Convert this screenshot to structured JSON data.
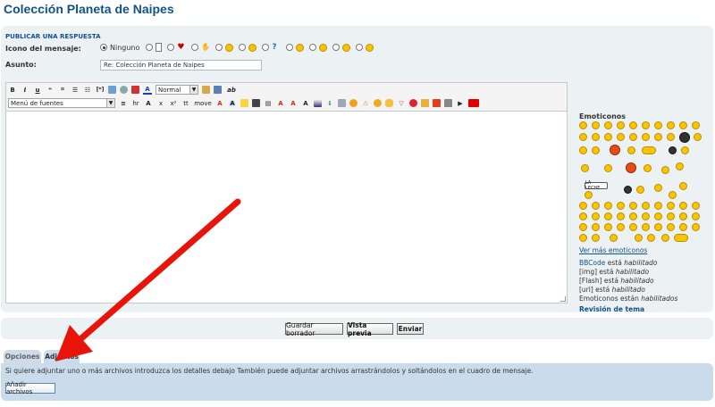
{
  "page": {
    "title": "Colección Planeta de Naipes"
  },
  "form": {
    "heading": "PUBLICAR UNA RESPUESTA",
    "icon_label": "Icono del mensaje:",
    "icon_none_label": "Ninguno",
    "subject_label": "Asunto:",
    "subject_value": "Re: Colección Planeta de Naipes"
  },
  "toolbar": {
    "bold": "B",
    "italic": "i",
    "underline": "u",
    "size_value": "Normal",
    "ab": "ab",
    "font_menu_value": "Menú de fuentes",
    "hr": "hr",
    "x_sub": "x",
    "x_sup": "x²",
    "tt": "tt",
    "move": "move"
  },
  "sidebar": {
    "emoticons_title": "Emoticonos",
    "sign_text": "LA LECHE",
    "more_emoticons": "Ver más emoticonos",
    "status": {
      "bbcode": {
        "prefix": "BBCode",
        "mid": "está",
        "state": "habilitado"
      },
      "img": {
        "prefix": "[img]",
        "mid": "está",
        "state": "habilitado"
      },
      "flash": {
        "prefix": "[Flash]",
        "mid": "está",
        "state": "habilitado"
      },
      "url": {
        "prefix": "[url]",
        "mid": "está",
        "state": "habilitado"
      },
      "emoticons": {
        "prefix": "Emoticonos",
        "mid": "están",
        "state": "habilitados"
      }
    },
    "revision_link": "Revisión de tema"
  },
  "actions": {
    "save_draft": "Guardar borrador",
    "preview": "Vista previa",
    "submit": "Enviar"
  },
  "tabs": [
    {
      "label": "Opciones"
    },
    {
      "label": "Adjuntos"
    }
  ],
  "attachments": {
    "help_text": "Si quiere adjuntar uno o más archivos introduzca los detalles debajo También puede adjuntar archivos arrastrándolos y soltándolos en el cuadro de mensaje.",
    "add_files_button": "Añadir archivos"
  },
  "colors": {
    "link": "#105289",
    "panel_bg": "#ecf1f3",
    "attach_bg": "#cadceb",
    "arrow": "#e8140a"
  }
}
